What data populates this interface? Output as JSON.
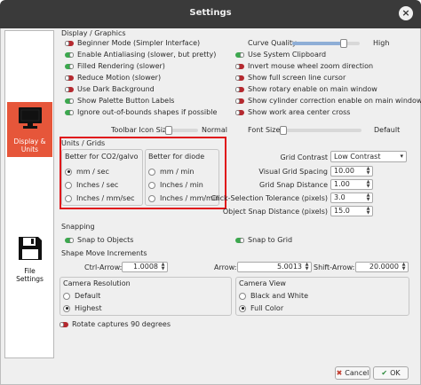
{
  "window": {
    "title": "Settings"
  },
  "sidebar": {
    "items": [
      {
        "label": "Display &\nUnits",
        "icon": "monitor-icon",
        "active": true
      },
      {
        "label": "File\nSettings",
        "icon": "floppy-disk-icon",
        "active": false
      }
    ]
  },
  "display": {
    "heading": "Display / Graphics",
    "left_toggles": [
      {
        "label": "Beginner Mode (Simpler Interface)",
        "on": false
      },
      {
        "label": "Enable Antialiasing (slower, but pretty)",
        "on": true
      },
      {
        "label": "Filled Rendering (slower)",
        "on": true
      },
      {
        "label": "Reduce Motion (slower)",
        "on": false
      },
      {
        "label": "Use Dark Background",
        "on": false
      },
      {
        "label": "Show Palette Button Labels",
        "on": true
      },
      {
        "label": "Ignore out-of-bounds shapes if possible",
        "on": true
      }
    ],
    "curve_quality": {
      "label": "Curve Quality",
      "high_label": "High",
      "value": 0.8
    },
    "right_toggles": [
      {
        "label": "Use System Clipboard",
        "on": true
      },
      {
        "label": "Invert mouse wheel zoom direction",
        "on": false
      },
      {
        "label": "Show full screen line cursor",
        "on": false
      },
      {
        "label": "Show rotary enable on main window",
        "on": false
      },
      {
        "label": "Show cylinder correction enable on main window",
        "on": false
      },
      {
        "label": "Show work area center cross",
        "on": false
      }
    ],
    "toolbar_icon_size": {
      "label": "Toolbar Icon Size",
      "value_label": "Normal",
      "value": 0.02
    },
    "font_size": {
      "label": "Font Size",
      "value_label": "Default",
      "value": 0.0
    }
  },
  "units": {
    "heading": "Units / Grids",
    "co2_group": {
      "title": "Better for CO2/galvo",
      "options": [
        "mm / sec",
        "Inches / sec",
        "Inches / mm/sec"
      ],
      "selected": 0
    },
    "diode_group": {
      "title": "Better for diode",
      "options": [
        "mm / min",
        "Inches / min",
        "Inches / mm/min"
      ],
      "selected": -1
    },
    "grid_contrast": {
      "label": "Grid Contrast",
      "value": "Low Contrast"
    },
    "visual_grid_spacing": {
      "label": "Visual Grid Spacing",
      "value": "10.00"
    },
    "grid_snap_distance": {
      "label": "Grid Snap Distance",
      "value": "1.00"
    },
    "click_tolerance": {
      "label": "Click-Selection Tolerance (pixels)",
      "value": "3.0"
    },
    "object_snap_distance": {
      "label": "Object Snap Distance (pixels)",
      "value": "15.0"
    }
  },
  "snapping": {
    "heading": "Snapping",
    "snap_objects": {
      "label": "Snap to Objects",
      "on": true
    },
    "snap_grid": {
      "label": "Snap to Grid",
      "on": true
    }
  },
  "shape_move": {
    "heading": "Shape Move Increments",
    "ctrl_arrow": {
      "label": "Ctrl-Arrow:",
      "value": "1.0008"
    },
    "arrow": {
      "label": "Arrow:",
      "value": "5.0013"
    },
    "shift_arrow": {
      "label": "Shift-Arrow:",
      "value": "20.0000"
    }
  },
  "camera_resolution": {
    "heading": "Camera Resolution",
    "options": [
      "Default",
      "Highest"
    ],
    "selected": 1
  },
  "camera_view": {
    "heading": "Camera View",
    "options": [
      "Black and White",
      "Full Color"
    ],
    "selected": 1
  },
  "rotate_captures": {
    "label": "Rotate captures 90 degrees",
    "on": false
  },
  "buttons": {
    "cancel": "Cancel",
    "ok": "OK"
  }
}
